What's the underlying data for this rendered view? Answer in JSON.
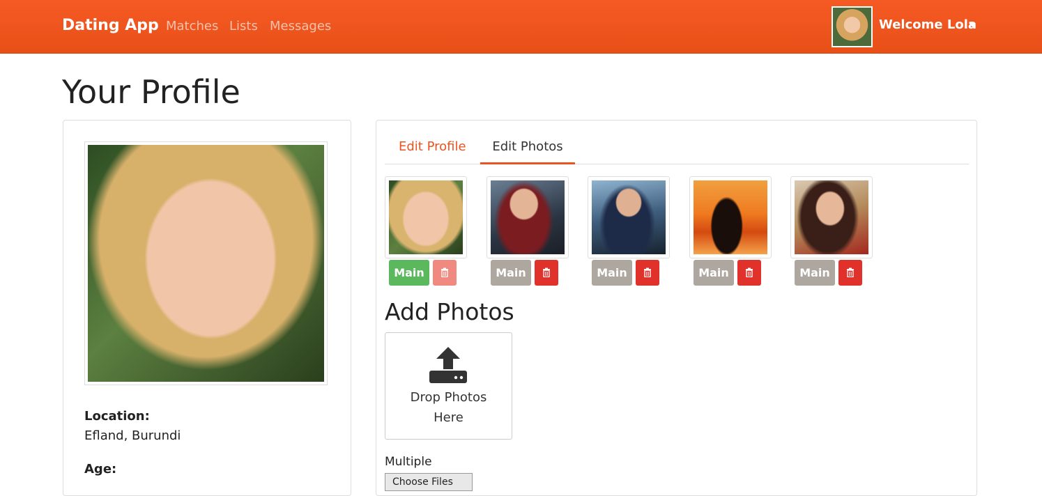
{
  "navbar": {
    "brand": "Dating App",
    "links": [
      "Matches",
      "Lists",
      "Messages"
    ],
    "welcome": "Welcome Lola",
    "accent_color": "#e95420"
  },
  "page": {
    "title": "Your Profile"
  },
  "profile": {
    "location_label": "Location:",
    "location_value": "Efland, Burundi",
    "age_label": "Age:"
  },
  "tabs": {
    "edit_profile": "Edit Profile",
    "edit_photos": "Edit Photos",
    "active": "Edit Photos"
  },
  "photos": {
    "main_label": "Main",
    "items": [
      {
        "is_main": true
      },
      {
        "is_main": false
      },
      {
        "is_main": false
      },
      {
        "is_main": false
      },
      {
        "is_main": false
      }
    ]
  },
  "upload": {
    "title": "Add Photos",
    "drop_line1": "Drop Photos",
    "drop_line2": "Here",
    "multiple_label": "Multiple",
    "choose_file": "Choose Files"
  },
  "icons": {
    "delete": "trash-icon",
    "upload": "upload-icon",
    "dropdown": "caret-down-icon"
  }
}
